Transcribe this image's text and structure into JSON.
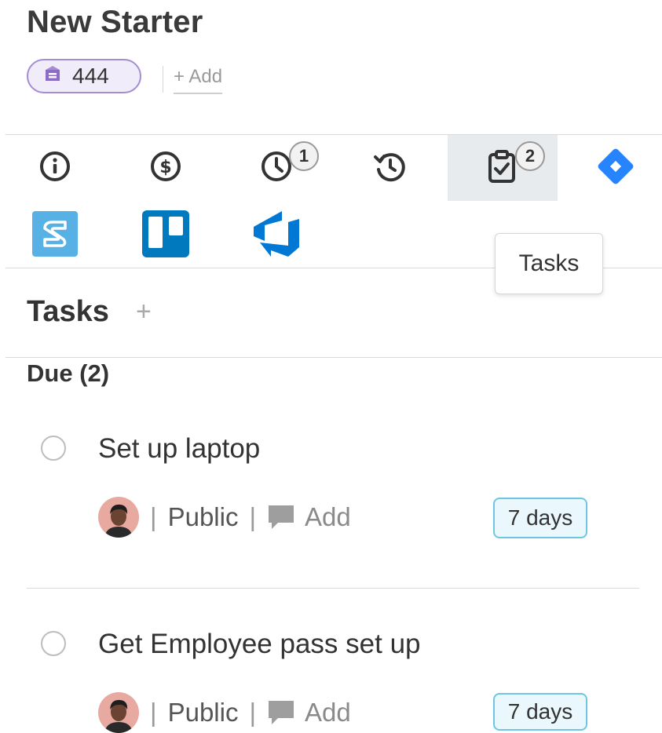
{
  "header": {
    "title": "New Starter",
    "ticket_count": "444",
    "add_label": "+ Add"
  },
  "tabs": [
    {
      "name": "info",
      "icon": "info-icon"
    },
    {
      "name": "billing",
      "icon": "dollar-icon"
    },
    {
      "name": "timers",
      "icon": "clock-icon",
      "count": "1"
    },
    {
      "name": "history",
      "icon": "history-icon"
    },
    {
      "name": "tasks",
      "icon": "clipboard-check-icon",
      "count": "2",
      "active": true
    },
    {
      "name": "jira",
      "icon": "jira-icon"
    },
    {
      "name": "shortcut",
      "icon": "shortcut-icon"
    },
    {
      "name": "trello",
      "icon": "trello-icon"
    },
    {
      "name": "azure-devops",
      "icon": "azure-devops-icon"
    }
  ],
  "tooltip": "Tasks",
  "tasks_section": {
    "title": "Tasks",
    "add_symbol": "+",
    "group_label": "Due (2)",
    "items": [
      {
        "name": "Set up laptop",
        "visibility": "Public",
        "comment_label": "Add",
        "due": "7 days"
      },
      {
        "name": "Get Employee pass set up",
        "visibility": "Public",
        "comment_label": "Add",
        "due": "7 days"
      }
    ]
  },
  "colors": {
    "ticket_badge_border": "#a48cd2",
    "jira_blue": "#2684ff",
    "trello_blue": "#0079bf",
    "azure_blue": "#0078d4",
    "due_badge_border": "#6fc6e3"
  }
}
